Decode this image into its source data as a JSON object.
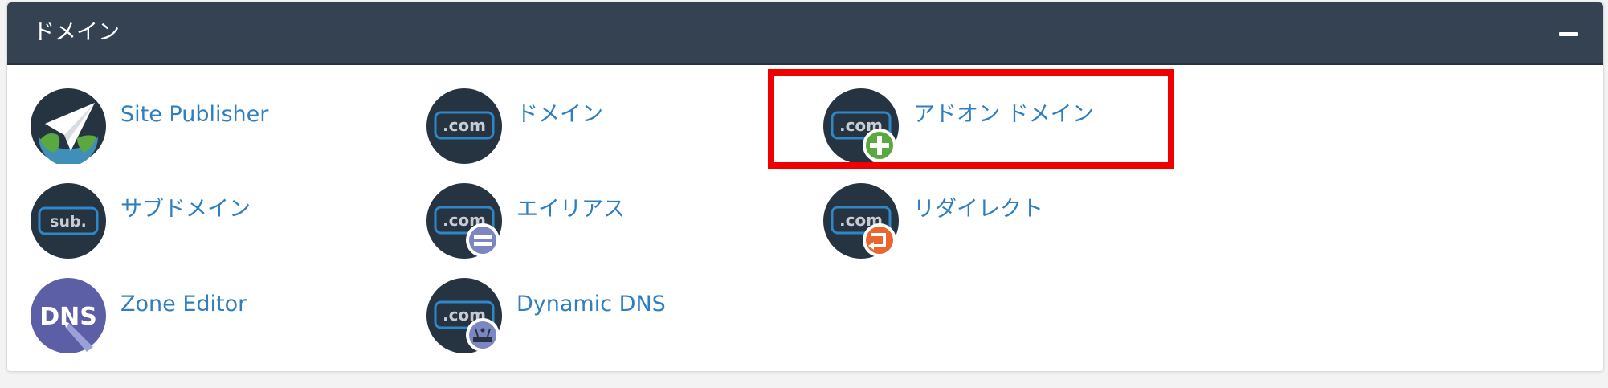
{
  "panel": {
    "title": "ドメイン",
    "collapse_icon": "minus-icon"
  },
  "items": [
    {
      "label": "Site Publisher",
      "icon": "paper-plane-globe-icon"
    },
    {
      "label": "ドメイン",
      "icon": "dotcom-icon",
      "icon_text": ".com"
    },
    {
      "label": "アドオン ドメイン",
      "icon": "dotcom-plus-icon",
      "icon_text": ".com"
    },
    {
      "label": "サブドメイン",
      "icon": "sub-domain-icon",
      "icon_text": "sub."
    },
    {
      "label": "エイリアス",
      "icon": "dotcom-equals-icon",
      "icon_text": ".com"
    },
    {
      "label": "リダイレクト",
      "icon": "dotcom-redirect-icon",
      "icon_text": ".com"
    },
    {
      "label": "Zone Editor",
      "icon": "dns-pencil-icon",
      "icon_text": "DNS"
    },
    {
      "label": "Dynamic DNS",
      "icon": "dotcom-router-icon",
      "icon_text": ".com"
    }
  ],
  "colors": {
    "header_bg": "#354252",
    "link": "#2f7fc0",
    "icon_bg": "#263341",
    "highlight": "#f00000",
    "badge_green": "#5aa83f",
    "badge_purple": "#7b86c2",
    "badge_orange": "#e8662f"
  }
}
